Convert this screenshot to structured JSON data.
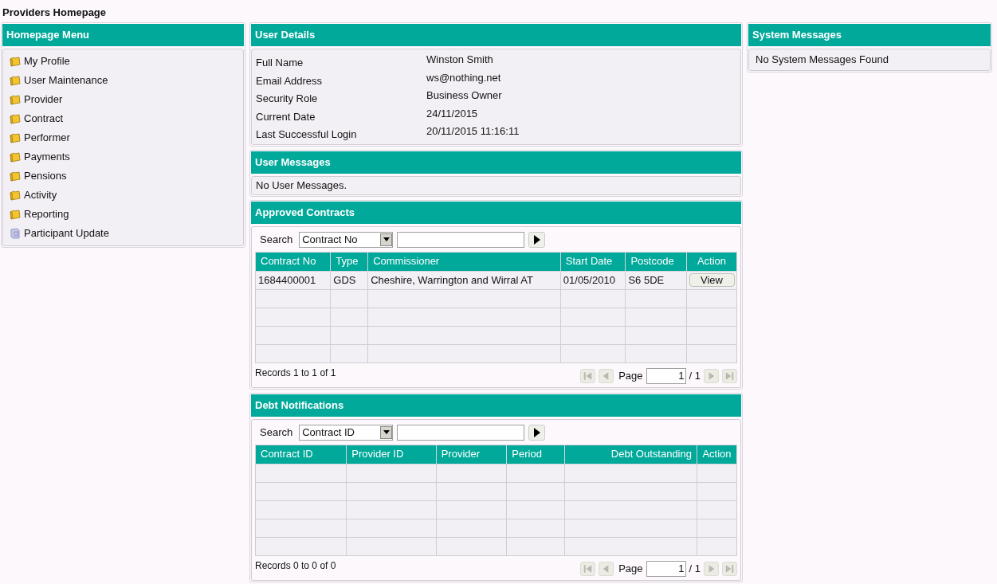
{
  "page_title": "Providers Homepage",
  "menu": {
    "title": "Homepage Menu",
    "items": [
      {
        "label": "My Profile",
        "kind": "folder"
      },
      {
        "label": "User Maintenance",
        "kind": "folder"
      },
      {
        "label": "Provider",
        "kind": "folder"
      },
      {
        "label": "Contract",
        "kind": "folder"
      },
      {
        "label": "Performer",
        "kind": "folder"
      },
      {
        "label": "Payments",
        "kind": "folder"
      },
      {
        "label": "Pensions",
        "kind": "folder"
      },
      {
        "label": "Activity",
        "kind": "folder"
      },
      {
        "label": "Reporting",
        "kind": "folder"
      },
      {
        "label": "Participant Update",
        "kind": "page"
      }
    ]
  },
  "user_details": {
    "title": "User Details",
    "fields": [
      {
        "label": "Full Name",
        "value": "Winston Smith"
      },
      {
        "label": "Email Address",
        "value": "ws@nothing.net"
      },
      {
        "label": "Security Role",
        "value": "Business Owner"
      },
      {
        "label": "Current Date",
        "value": "24/11/2015"
      },
      {
        "label": "Last Successful Login",
        "value": "20/11/2015 11:16:11"
      }
    ]
  },
  "user_messages": {
    "title": "User Messages",
    "message": "No User Messages."
  },
  "approved_contracts": {
    "title": "Approved Contracts",
    "search": {
      "label": "Search",
      "field": "Contract No"
    },
    "columns": [
      {
        "label": "Contract No",
        "kind": "text"
      },
      {
        "label": "Type",
        "kind": "text"
      },
      {
        "label": "Commissioner",
        "kind": "text"
      },
      {
        "label": "Start Date",
        "kind": "text"
      },
      {
        "label": "Postcode",
        "kind": "text"
      },
      {
        "label": "Action",
        "kind": "action"
      }
    ],
    "rows": [
      {
        "cells": [
          "1684400001",
          "GDS",
          "Cheshire, Warrington and Wirral AT",
          "01/05/2010",
          "S6 5DE"
        ],
        "action": "View"
      }
    ],
    "records": "Records 1 to 1 of 1",
    "pager": {
      "label": "Page",
      "page": "1",
      "total": "/ 1",
      "first_disabled": true,
      "prev_disabled": true,
      "next_disabled": true,
      "last_disabled": true
    }
  },
  "debt_notifications": {
    "title": "Debt Notifications",
    "search": {
      "label": "Search",
      "field": "Contract ID"
    },
    "columns": [
      {
        "label": "Contract ID",
        "kind": "text"
      },
      {
        "label": "Provider ID",
        "kind": "text"
      },
      {
        "label": "Provider",
        "kind": "text"
      },
      {
        "label": "Period",
        "kind": "text"
      },
      {
        "label": "Debt Outstanding",
        "kind": "amount"
      },
      {
        "label": "Action",
        "kind": "action"
      }
    ],
    "records": "Records 0 to 0 of 0",
    "pager": {
      "label": "Page",
      "page": "1",
      "total": "/ 1",
      "first_disabled": true,
      "prev_disabled": true,
      "next_disabled": true,
      "last_disabled": true
    }
  },
  "system_messages": {
    "title": "System Messages",
    "message": "No System Messages Found"
  }
}
